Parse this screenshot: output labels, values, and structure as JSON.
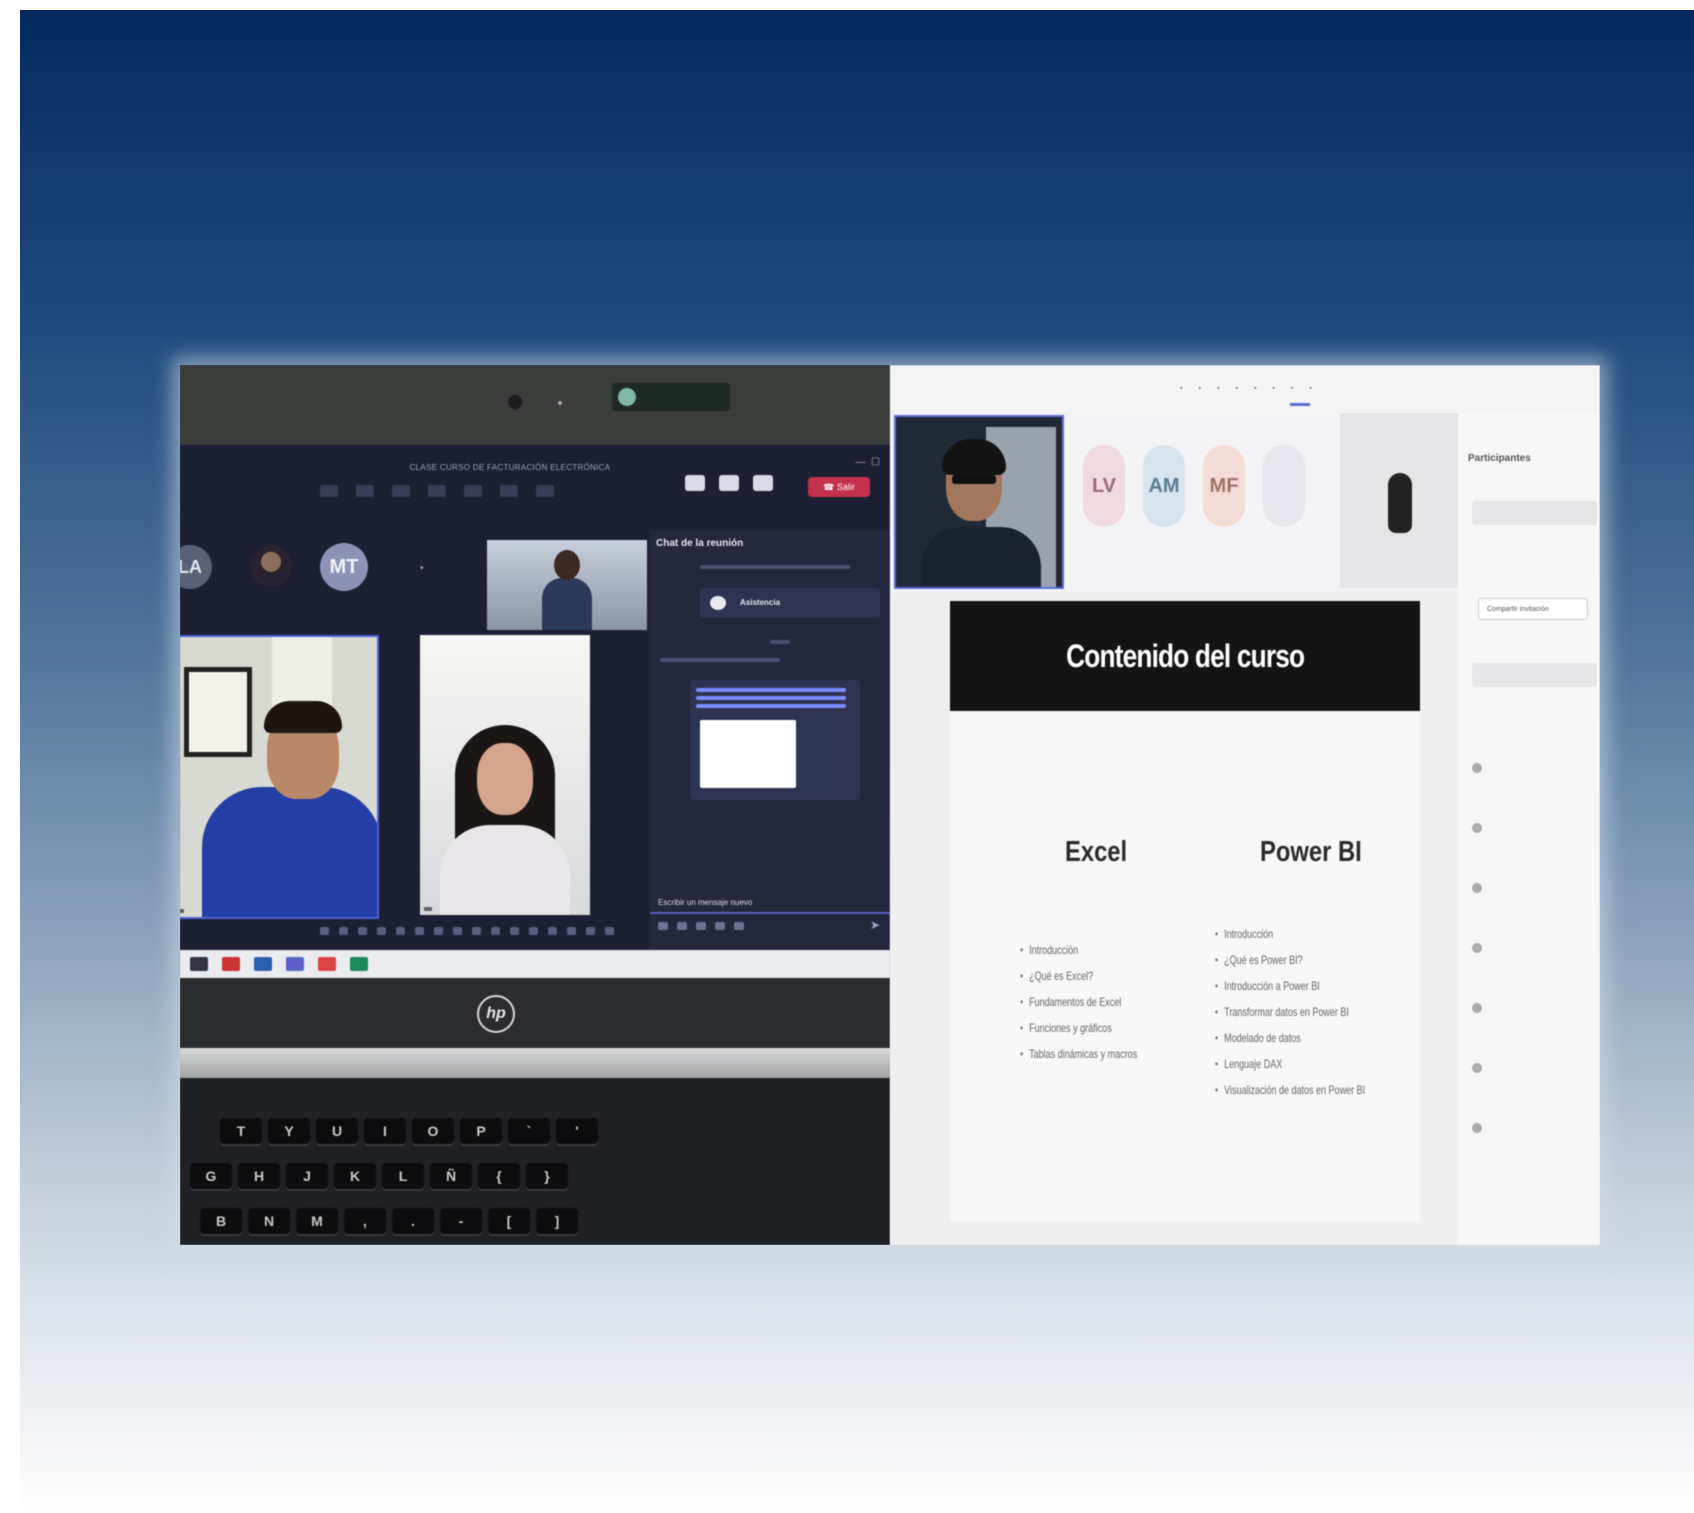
{
  "laptop": {
    "meeting_title": "CLASE CURSO DE FACTURACIÓN ELECTRÓNICA",
    "leave_label": "Salir",
    "avatars": [
      {
        "initials": "LA"
      },
      {
        "initials": ""
      },
      {
        "initials": "MT"
      }
    ],
    "chat": {
      "title": "Chat de la reunión",
      "card_label": "Asistencia",
      "compose_placeholder": "Escribir un mensaje nuevo"
    },
    "keyboard_rows": [
      [
        "T",
        "Y",
        "U",
        "I",
        "O",
        "P",
        "`",
        "'"
      ],
      [
        "G",
        "H",
        "J",
        "K",
        "L",
        "Ñ",
        "{",
        "}"
      ],
      [
        "B",
        "N",
        "M",
        ",",
        ".",
        "-",
        "[",
        "]"
      ]
    ],
    "brand": "hp"
  },
  "presentation": {
    "participants_title": "Participantes",
    "share_label": "Compartir invitación",
    "avatars": [
      {
        "initials": "LV"
      },
      {
        "initials": "AM"
      },
      {
        "initials": "MF"
      }
    ],
    "slide": {
      "title": "Contenido del curso",
      "columns": [
        {
          "heading": "Excel",
          "items": [
            "Introducción",
            "¿Qué es Excel?",
            "Fundamentos de Excel",
            "Funciones y gráficos",
            "Tablas dinámicas y macros"
          ]
        },
        {
          "heading": "Power BI",
          "items": [
            "Introducción",
            "¿Qué es Power BI?",
            "Introducción a Power BI",
            "Transformar datos en Power BI",
            "Modelado de datos",
            "Lenguaje DAX",
            "Visualización de datos en Power BI"
          ]
        }
      ]
    }
  }
}
